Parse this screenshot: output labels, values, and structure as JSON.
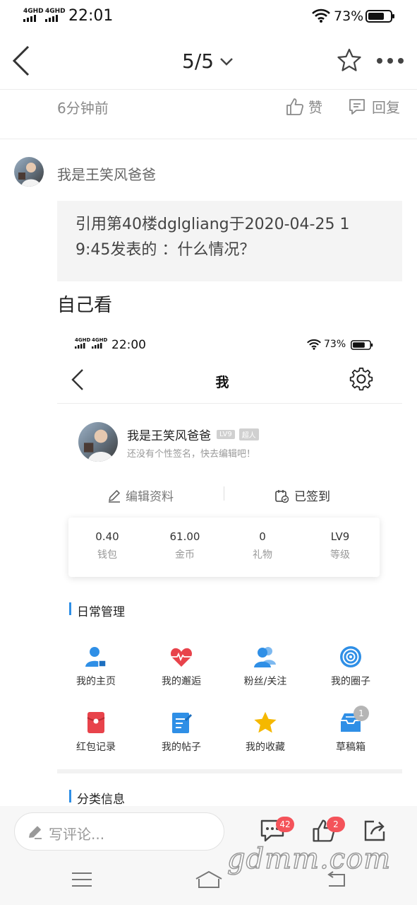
{
  "status_bar": {
    "net1": "4GHD",
    "net2": "4GHD",
    "time": "22:01",
    "battery": "73%"
  },
  "header": {
    "page_indicator": "5/5"
  },
  "prev_post": {
    "time": "6分钟前",
    "like_label": "赞",
    "reply_label": "回复"
  },
  "post": {
    "username": "我是王笑风爸爸",
    "quote_line1": "引用第40楼dglgliang于2020-04-25 1",
    "quote_line2": "9:45发表的 ：什么情况？",
    "content": "自己看"
  },
  "embedded": {
    "status_bar": {
      "net1": "4GHD",
      "net2": "4GHD",
      "time": "22:00",
      "battery": "73%"
    },
    "title": "我",
    "profile": {
      "name": "我是王笑风爸爸",
      "level_tag": "LV9",
      "role_tag": "超人",
      "signature": "还没有个性签名，快去编辑吧！"
    },
    "actions": {
      "edit": "编辑资料",
      "signed": "已签到"
    },
    "stats": [
      {
        "value": "0.40",
        "label": "钱包"
      },
      {
        "value": "61.00",
        "label": "金币"
      },
      {
        "value": "0",
        "label": "礼物"
      },
      {
        "value": "LV9",
        "label": "等级"
      }
    ],
    "daily_title": "日常管理",
    "grid": [
      {
        "label": "我的主页",
        "icon": "user-home-icon"
      },
      {
        "label": "我的邂逅",
        "icon": "heart-pulse-icon"
      },
      {
        "label": "粉丝/关注",
        "icon": "fans-icon"
      },
      {
        "label": "我的圈子",
        "icon": "circle-target-icon"
      },
      {
        "label": "红包记录",
        "icon": "red-envelope-icon"
      },
      {
        "label": "我的帖子",
        "icon": "post-edit-icon"
      },
      {
        "label": "我的收藏",
        "icon": "star-icon"
      },
      {
        "label": "草稿箱",
        "icon": "drafts-icon",
        "badge": "1"
      }
    ],
    "category_title": "分类信息"
  },
  "bottom": {
    "comment_placeholder": "写评论...",
    "comment_badge": "42",
    "like_badge": "2"
  },
  "watermark": "gdmm.com",
  "colors": {
    "accent_blue": "#2f8fe6",
    "badge_red": "#f4535a",
    "heart_red": "#e8434b"
  }
}
